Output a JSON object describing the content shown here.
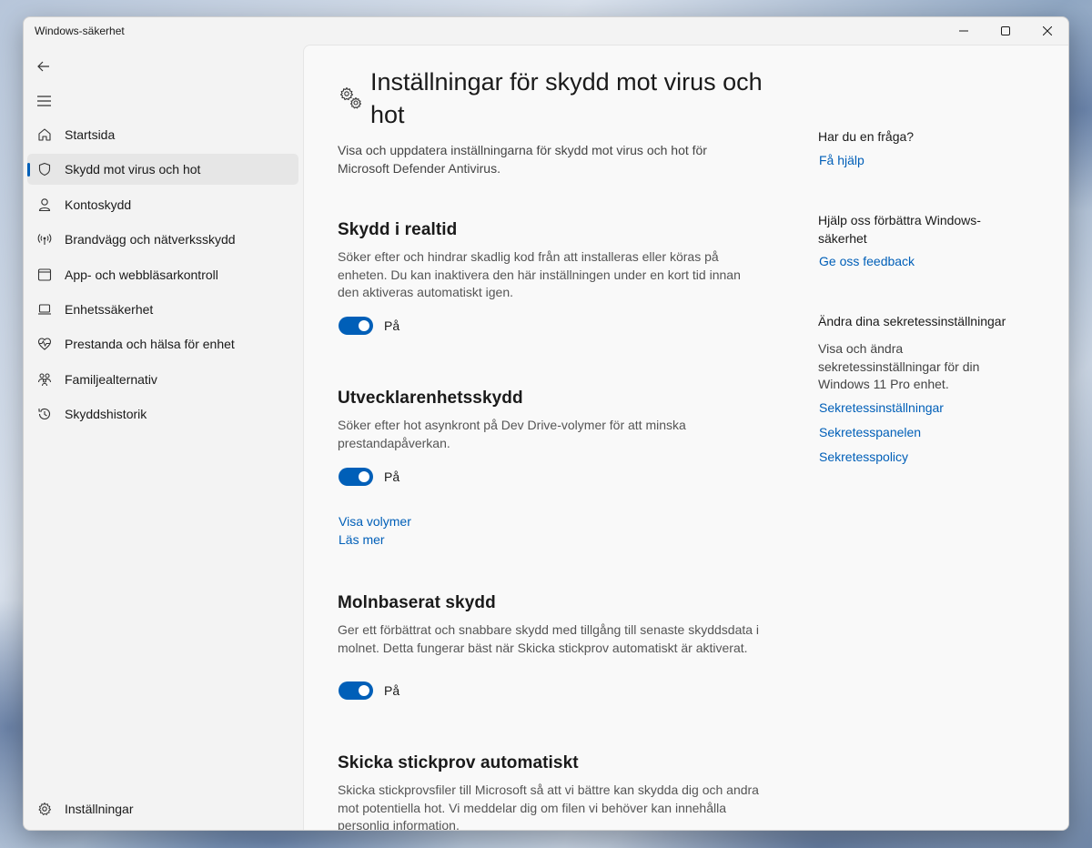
{
  "window": {
    "title": "Windows-säkerhet",
    "controls": {
      "minimize": "minimize-icon",
      "maximize": "maximize-icon",
      "close": "close-icon"
    }
  },
  "nav": {
    "back_icon": "back-arrow-icon",
    "menu_icon": "hamburger-icon",
    "items": [
      {
        "label": "Startsida",
        "icon": "home-icon"
      },
      {
        "label": "Skydd mot virus och hot",
        "icon": "shield-icon",
        "selected": true
      },
      {
        "label": "Kontoskydd",
        "icon": "person-icon"
      },
      {
        "label": "Brandvägg och nätverksskydd",
        "icon": "wireless-icon"
      },
      {
        "label": "App- och webbläsarkontroll",
        "icon": "app-window-icon"
      },
      {
        "label": "Enhetssäkerhet",
        "icon": "laptop-icon"
      },
      {
        "label": "Prestanda och hälsa för enhet",
        "icon": "heartbeat-icon"
      },
      {
        "label": "Familjealternativ",
        "icon": "family-icon"
      },
      {
        "label": "Skyddshistorik",
        "icon": "history-icon"
      }
    ],
    "settings": {
      "label": "Inställningar",
      "icon": "gear-icon"
    }
  },
  "main": {
    "title_icon": "gears-icon",
    "title": "Inställningar för skydd mot virus och hot",
    "description": "Visa och uppdatera inställningarna för skydd mot virus och hot för Microsoft Defender Antivirus.",
    "sections": [
      {
        "title": "Skydd i realtid",
        "description": "Söker efter och hindrar skadlig kod från att installeras eller köras på enheten. Du kan inaktivera den här inställningen under en kort tid innan den aktiveras automatiskt igen.",
        "toggle_state": "on",
        "toggle_label": "På"
      },
      {
        "title": "Utvecklarenhetsskydd",
        "description": "Söker efter hot asynkront på Dev Drive-volymer för att minska prestandapåverkan.",
        "toggle_state": "on",
        "toggle_label": "På",
        "links": [
          "Visa volymer",
          "Läs mer"
        ]
      },
      {
        "title": "Molnbaserat skydd",
        "description": "Ger ett förbättrat och snabbare skydd med tillgång till senaste skyddsdata i molnet. Detta fungerar bäst när Skicka stickprov automatiskt är aktiverat.",
        "toggle_state": "on",
        "toggle_label": "På"
      },
      {
        "title": "Skicka stickprov automatiskt",
        "description": "Skicka stickprovsfiler till Microsoft så att vi bättre kan skydda dig och andra mot potentiella hot. Vi meddelar dig om filen vi behöver kan innehålla personlig information."
      }
    ]
  },
  "sidebar_right": {
    "question_heading": "Har du en fråga?",
    "help_link": "Få hjälp",
    "feedback_heading": "Hjälp oss förbättra Windows-säkerhet",
    "feedback_link": "Ge oss feedback",
    "privacy_heading": "Ändra dina sekretessinställningar",
    "privacy_text": "Visa och ändra sekretessinställningar för din Windows 11 Pro enhet.",
    "privacy_links": [
      "Sekretessinställningar",
      "Sekretesspanelen",
      "Sekretesspolicy"
    ]
  },
  "colors": {
    "accent": "#005fb8",
    "selected_bg": "#e6e6e6",
    "content_bg": "#f9f9f9"
  }
}
